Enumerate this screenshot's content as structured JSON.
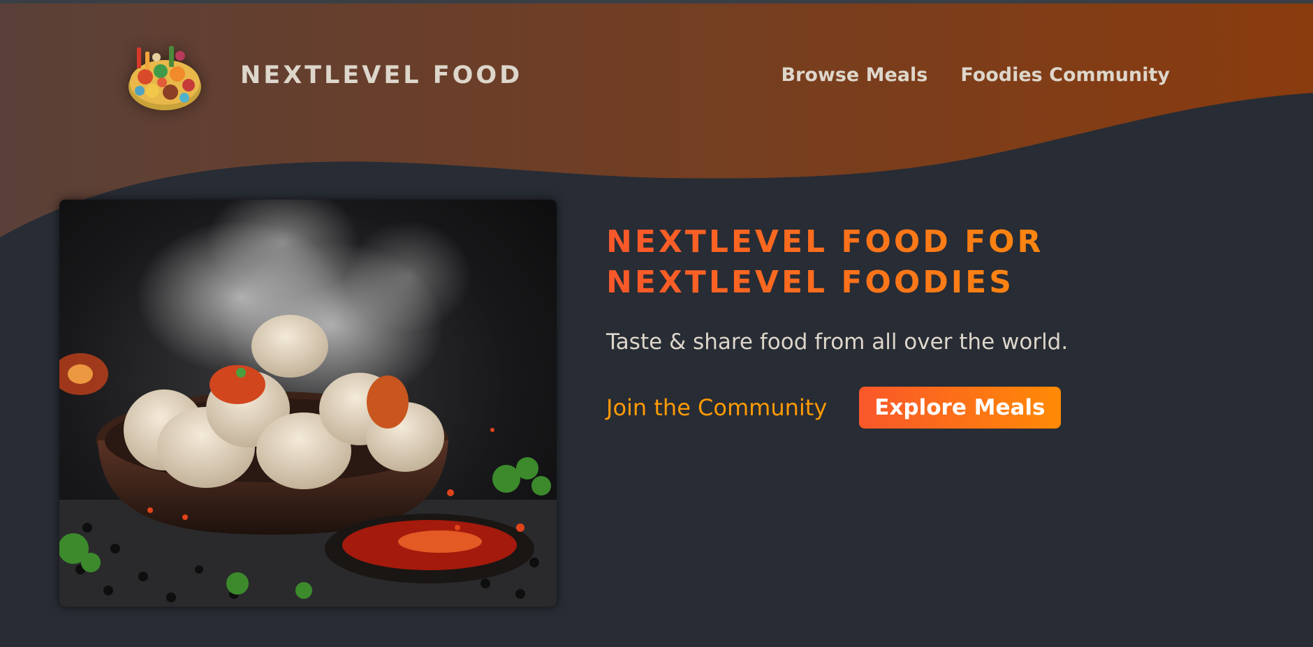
{
  "header": {
    "logo_text": "NEXTLEVEL FOOD",
    "logo_icon": "food-platter-logo",
    "nav": [
      {
        "label": "Browse Meals"
      },
      {
        "label": "Foodies Community"
      }
    ]
  },
  "hero": {
    "title_line1": "NEXTLEVEL FOOD FOR",
    "title_line2": "NEXTLEVEL FOODIES",
    "subtitle": "Taste & share food from all over the world.",
    "join_link": "Join the Community",
    "explore_button": "Explore Meals",
    "image_subject": "steaming-dumplings-bowl-image"
  },
  "colors": {
    "background": "#282c34",
    "header_gradient_start": "#5a4038",
    "header_gradient_end": "#8a3c0e",
    "accent_start": "#f9572a",
    "accent_end": "#ff9b05",
    "text_light": "#ddd6cb"
  }
}
